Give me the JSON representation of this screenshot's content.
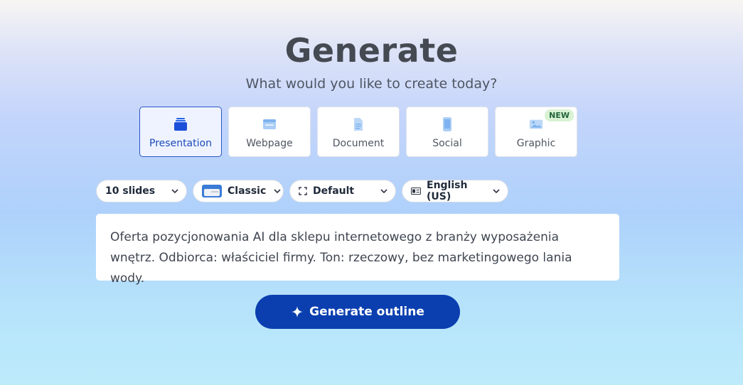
{
  "header": {
    "title": "Generate",
    "subtitle": "What would you like to create today?"
  },
  "content_types": [
    {
      "label": "Presentation",
      "icon": "presentation-icon",
      "active": true
    },
    {
      "label": "Webpage",
      "icon": "webpage-icon",
      "active": false
    },
    {
      "label": "Document",
      "icon": "document-icon",
      "active": false
    },
    {
      "label": "Social",
      "icon": "phone-icon",
      "active": false
    },
    {
      "label": "Graphic",
      "icon": "image-icon",
      "active": false,
      "badge": "NEW"
    }
  ],
  "options": {
    "slides": "10 slides",
    "theme": "Classic",
    "format": "Default",
    "language": "English (US)"
  },
  "prompt": {
    "text": "Oferta pozycjonowania AI dla sklepu internetowego z branży wyposażenia wnętrz. Odbiorca: właściciel firmy. Ton: rzeczowy, bez marketingowego lania wody."
  },
  "action": {
    "generate_label": "Generate outline"
  },
  "colors": {
    "accent": "#0b3fb0",
    "active_border": "#2a56c6",
    "badge_bg": "#d8f2d3"
  }
}
